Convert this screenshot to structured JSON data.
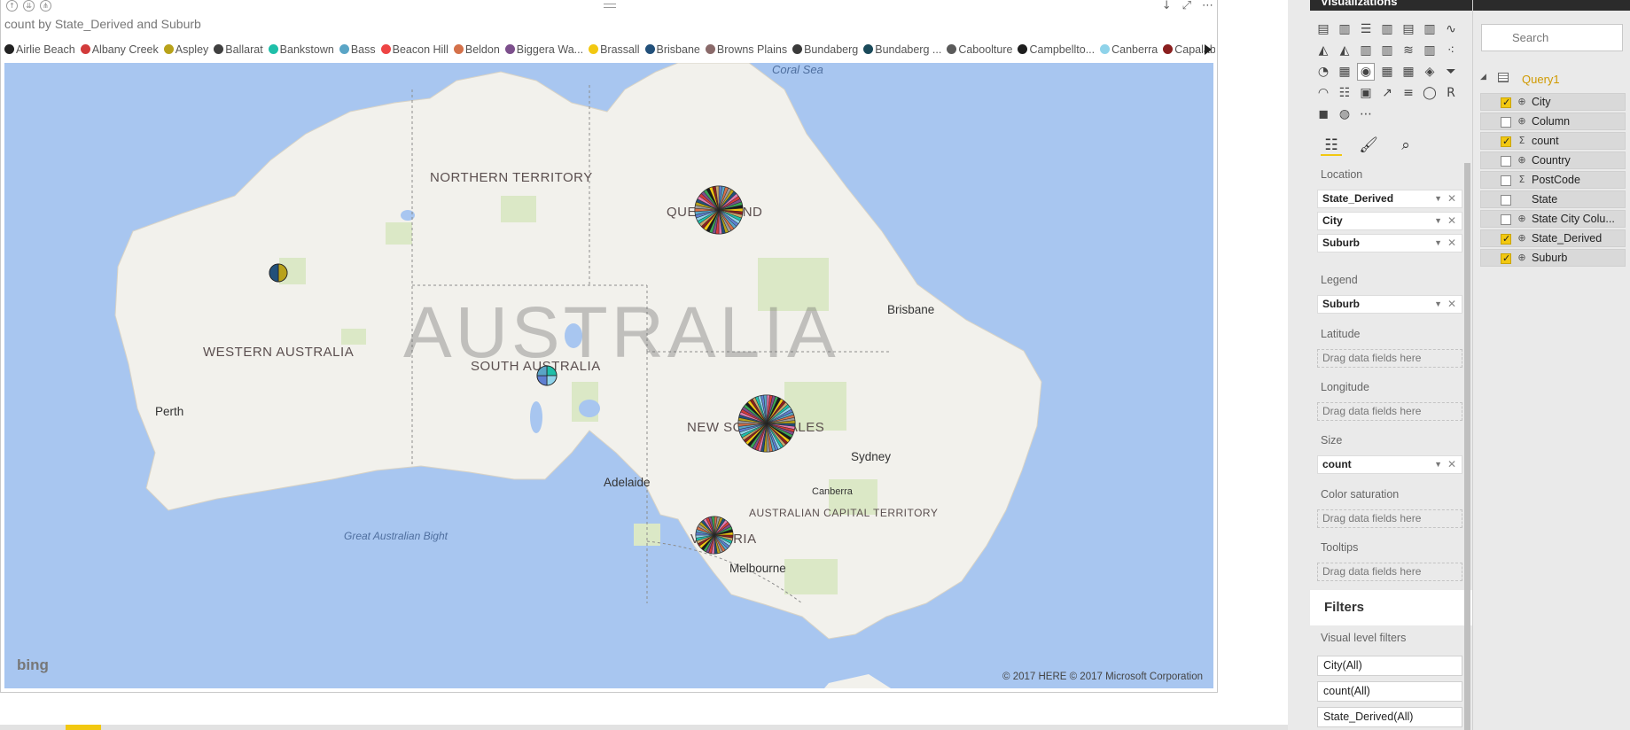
{
  "visual": {
    "title": "count by State_Derived and Suburb",
    "header_icons": [
      "arrow-up-icon",
      "double-arrow-down-icon",
      "drill-down-icon"
    ],
    "tools": [
      "↓",
      "⤢",
      "⋯"
    ]
  },
  "legend": {
    "items": [
      {
        "label": "Airlie Beach",
        "color": "#222222"
      },
      {
        "label": "Albany Creek",
        "color": "#d23b3b"
      },
      {
        "label": "Aspley",
        "color": "#b8a21a"
      },
      {
        "label": "Ballarat",
        "color": "#404040"
      },
      {
        "label": "Bankstown",
        "color": "#1fbfa9"
      },
      {
        "label": "Bass",
        "color": "#5aa5c6"
      },
      {
        "label": "Beacon Hill",
        "color": "#ee4444"
      },
      {
        "label": "Beldon",
        "color": "#d4714a"
      },
      {
        "label": "Biggera Wa...",
        "color": "#7c4f8c"
      },
      {
        "label": "Brassall",
        "color": "#f2c811"
      },
      {
        "label": "Brisbane",
        "color": "#22507a"
      },
      {
        "label": "Browns Plains",
        "color": "#8a6a6a"
      },
      {
        "label": "Bundaberg",
        "color": "#3a3a3a"
      },
      {
        "label": "Bundaberg ...",
        "color": "#1a4a5a"
      },
      {
        "label": "Caboolture",
        "color": "#5a5a5a"
      },
      {
        "label": "Campbellto...",
        "color": "#1e1e1e"
      },
      {
        "label": "Canberra",
        "color": "#8fd3ea"
      },
      {
        "label": "Capalaba",
        "color": "#8a1f1f"
      }
    ]
  },
  "map": {
    "country": "AUSTRALIA",
    "states": [
      {
        "label": "NORTHERN TERRITORY",
        "key": "nt"
      },
      {
        "label": "WESTERN AUSTRALIA",
        "key": "wa"
      },
      {
        "label": "SOUTH AUSTRALIA",
        "key": "sa"
      },
      {
        "label": "QUEENSLAND",
        "key": "qld"
      },
      {
        "label": "NEW SOUTH WALES",
        "key": "nsw"
      },
      {
        "label": "VICTORIA",
        "key": "vic"
      },
      {
        "label": "AUSTRALIAN CAPITAL TERRITORY",
        "key": "act"
      }
    ],
    "cities": {
      "perth": "Perth",
      "adelaide": "Adelaide",
      "brisbane": "Brisbane",
      "sydney": "Sydney",
      "canberra": "Canberra",
      "melbourne": "Melbourne"
    },
    "seas": {
      "coral": "Coral Sea",
      "bight": "Great Australian Bight"
    },
    "provider": "bing",
    "copyright": "© 2017 HERE   © 2017 Microsoft Corporation"
  },
  "visualizations_pane": {
    "title": "Visualizations",
    "gallery_icons": [
      "stacked-bar-icon",
      "stacked-column-icon",
      "clustered-bar-icon",
      "clustered-column-icon",
      "100-bar-icon",
      "100-column-icon",
      "line-icon",
      "area-icon",
      "stacked-area-icon",
      "line-column-icon",
      "line-clustered-icon",
      "ribbon-icon",
      "waterfall-icon",
      "scatter-icon",
      "pie-icon",
      "treemap-icon",
      "map-icon",
      "table-icon",
      "matrix-icon",
      "filled-map-icon",
      "funnel-icon",
      "gauge-icon",
      "multirow-card-icon",
      "card-icon",
      "kpi-icon",
      "slicer-icon",
      "donut-icon",
      "r-visual-icon",
      "shape-map-icon",
      "globe-icon",
      "more-icon"
    ],
    "selected_icon": "map-icon",
    "tabs": [
      "fields-tab-icon",
      "format-paint-icon",
      "analytics-icon"
    ],
    "wells": {
      "location": {
        "label": "Location",
        "fields": [
          "State_Derived",
          "City",
          "Suburb"
        ]
      },
      "legend": {
        "label": "Legend",
        "fields": [
          "Suburb"
        ]
      },
      "latitude": {
        "label": "Latitude",
        "placeholder": "Drag data fields here"
      },
      "longitude": {
        "label": "Longitude",
        "placeholder": "Drag data fields here"
      },
      "size": {
        "label": "Size",
        "fields": [
          "count"
        ]
      },
      "color_saturation": {
        "label": "Color saturation",
        "placeholder": "Drag data fields here"
      },
      "tooltips": {
        "label": "Tooltips",
        "placeholder": "Drag data fields here"
      }
    },
    "filters": {
      "title": "Filters",
      "subtitle": "Visual level filters",
      "items": [
        "City(All)",
        "count(All)",
        "State_Derived(All)"
      ]
    }
  },
  "fields_pane": {
    "search_placeholder": "Search",
    "table_name": "Query1",
    "fields": [
      {
        "name": "City",
        "type": "globe",
        "checked": true
      },
      {
        "name": "Column",
        "type": "globe",
        "checked": false
      },
      {
        "name": "count",
        "type": "sigma",
        "checked": true
      },
      {
        "name": "Country",
        "type": "globe",
        "checked": false
      },
      {
        "name": "PostCode",
        "type": "sigma",
        "checked": false
      },
      {
        "name": "State",
        "type": "none",
        "checked": false
      },
      {
        "name": "State City Colu...",
        "type": "globe",
        "checked": false
      },
      {
        "name": "State_Derived",
        "type": "globe",
        "checked": true
      },
      {
        "name": "Suburb",
        "type": "globe",
        "checked": true
      }
    ]
  },
  "pie_colors": [
    "#1a1a1a",
    "#d23b3b",
    "#b8a21a",
    "#5aa5c6",
    "#1fbfa9",
    "#f2c811",
    "#7c4f8c",
    "#22507a",
    "#d4714a",
    "#8fd3ea",
    "#8a1f1f",
    "#3aa655",
    "#e07bb1",
    "#9a9a9a",
    "#5f7fd1",
    "#c9a76a"
  ]
}
